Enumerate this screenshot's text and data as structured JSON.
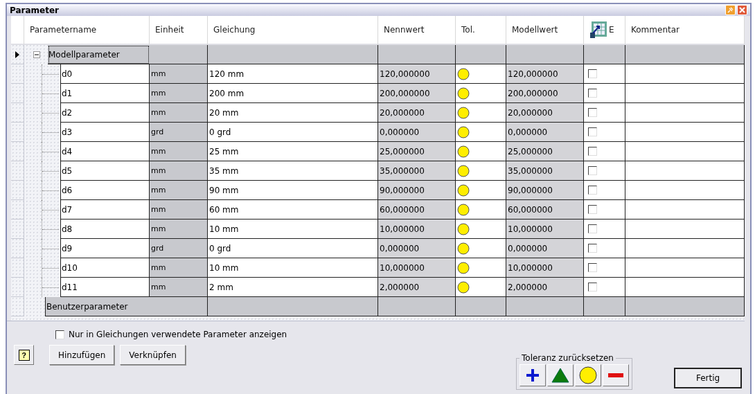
{
  "window": {
    "title": "Parameter"
  },
  "table": {
    "columns": [
      "Parametername",
      "Einheit",
      "Gleichung",
      "Nennwert",
      "Tol.",
      "Modellwert",
      "E",
      "Kommentar"
    ],
    "groups": [
      {
        "name": "Modellparameter",
        "selected": true,
        "expanded": true,
        "children": [
          {
            "name": "d0",
            "unit": "mm",
            "equation": "120 mm",
            "nominal": "120,000000",
            "tolerance": {
              "kind": "median"
            },
            "model": "120,000000",
            "exported": false
          },
          {
            "name": "d1",
            "unit": "mm",
            "equation": "200 mm",
            "nominal": "200,000000",
            "tolerance": {
              "kind": "median"
            },
            "model": "200,000000",
            "exported": false
          },
          {
            "name": "d2",
            "unit": "mm",
            "equation": "20 mm",
            "nominal": "20,000000",
            "tolerance": {
              "kind": "median"
            },
            "model": "20,000000",
            "exported": false
          },
          {
            "name": "d3",
            "unit": "grd",
            "equation": "0 grd",
            "nominal": "0,000000",
            "tolerance": {
              "kind": "median"
            },
            "model": "0,000000",
            "exported": false
          },
          {
            "name": "d4",
            "unit": "mm",
            "equation": "25 mm",
            "nominal": "25,000000",
            "tolerance": {
              "kind": "median"
            },
            "model": "25,000000",
            "exported": false
          },
          {
            "name": "d5",
            "unit": "mm",
            "equation": "35 mm",
            "nominal": "35,000000",
            "tolerance": {
              "kind": "median"
            },
            "model": "35,000000",
            "exported": false
          },
          {
            "name": "d6",
            "unit": "mm",
            "equation": "90 mm",
            "nominal": "90,000000",
            "tolerance": {
              "kind": "median"
            },
            "model": "90,000000",
            "exported": false
          },
          {
            "name": "d7",
            "unit": "mm",
            "equation": "60 mm",
            "nominal": "60,000000",
            "tolerance": {
              "kind": "median"
            },
            "model": "60,000000",
            "exported": false
          },
          {
            "name": "d8",
            "unit": "mm",
            "equation": "10 mm",
            "nominal": "10,000000",
            "tolerance": {
              "kind": "median"
            },
            "model": "10,000000",
            "exported": false
          },
          {
            "name": "d9",
            "unit": "grd",
            "equation": "0 grd",
            "nominal": "0,000000",
            "tolerance": {
              "kind": "median"
            },
            "model": "0,000000",
            "exported": false
          },
          {
            "name": "d10",
            "unit": "mm",
            "equation": "10 mm",
            "nominal": "10,000000",
            "tolerance": {
              "kind": "median"
            },
            "model": "10,000000",
            "exported": false
          },
          {
            "name": "d11",
            "unit": "mm",
            "equation": "2 mm",
            "nominal": "2,000000",
            "tolerance": {
              "kind": "median"
            },
            "model": "2,000000",
            "exported": false
          }
        ]
      },
      {
        "name": "Benutzerparameter",
        "selected": false
      }
    ]
  },
  "filter": {
    "label": "Nur in Gleichungen verwendete Parameter anzeigen",
    "checked": false
  },
  "buttons": [
    {
      "kind": "help",
      "label": "?"
    },
    {
      "kind": "text",
      "label": "Hinzufügen"
    },
    {
      "kind": "text",
      "label": "Verknüpfen"
    }
  ],
  "tolerance_reset": {
    "title": "Toleranz zurücksetzen",
    "buttons": [
      {
        "kind": "upper"
      },
      {
        "kind": "nominal"
      },
      {
        "kind": "median"
      },
      {
        "kind": "lower"
      }
    ]
  },
  "done_button": "Fertig"
}
